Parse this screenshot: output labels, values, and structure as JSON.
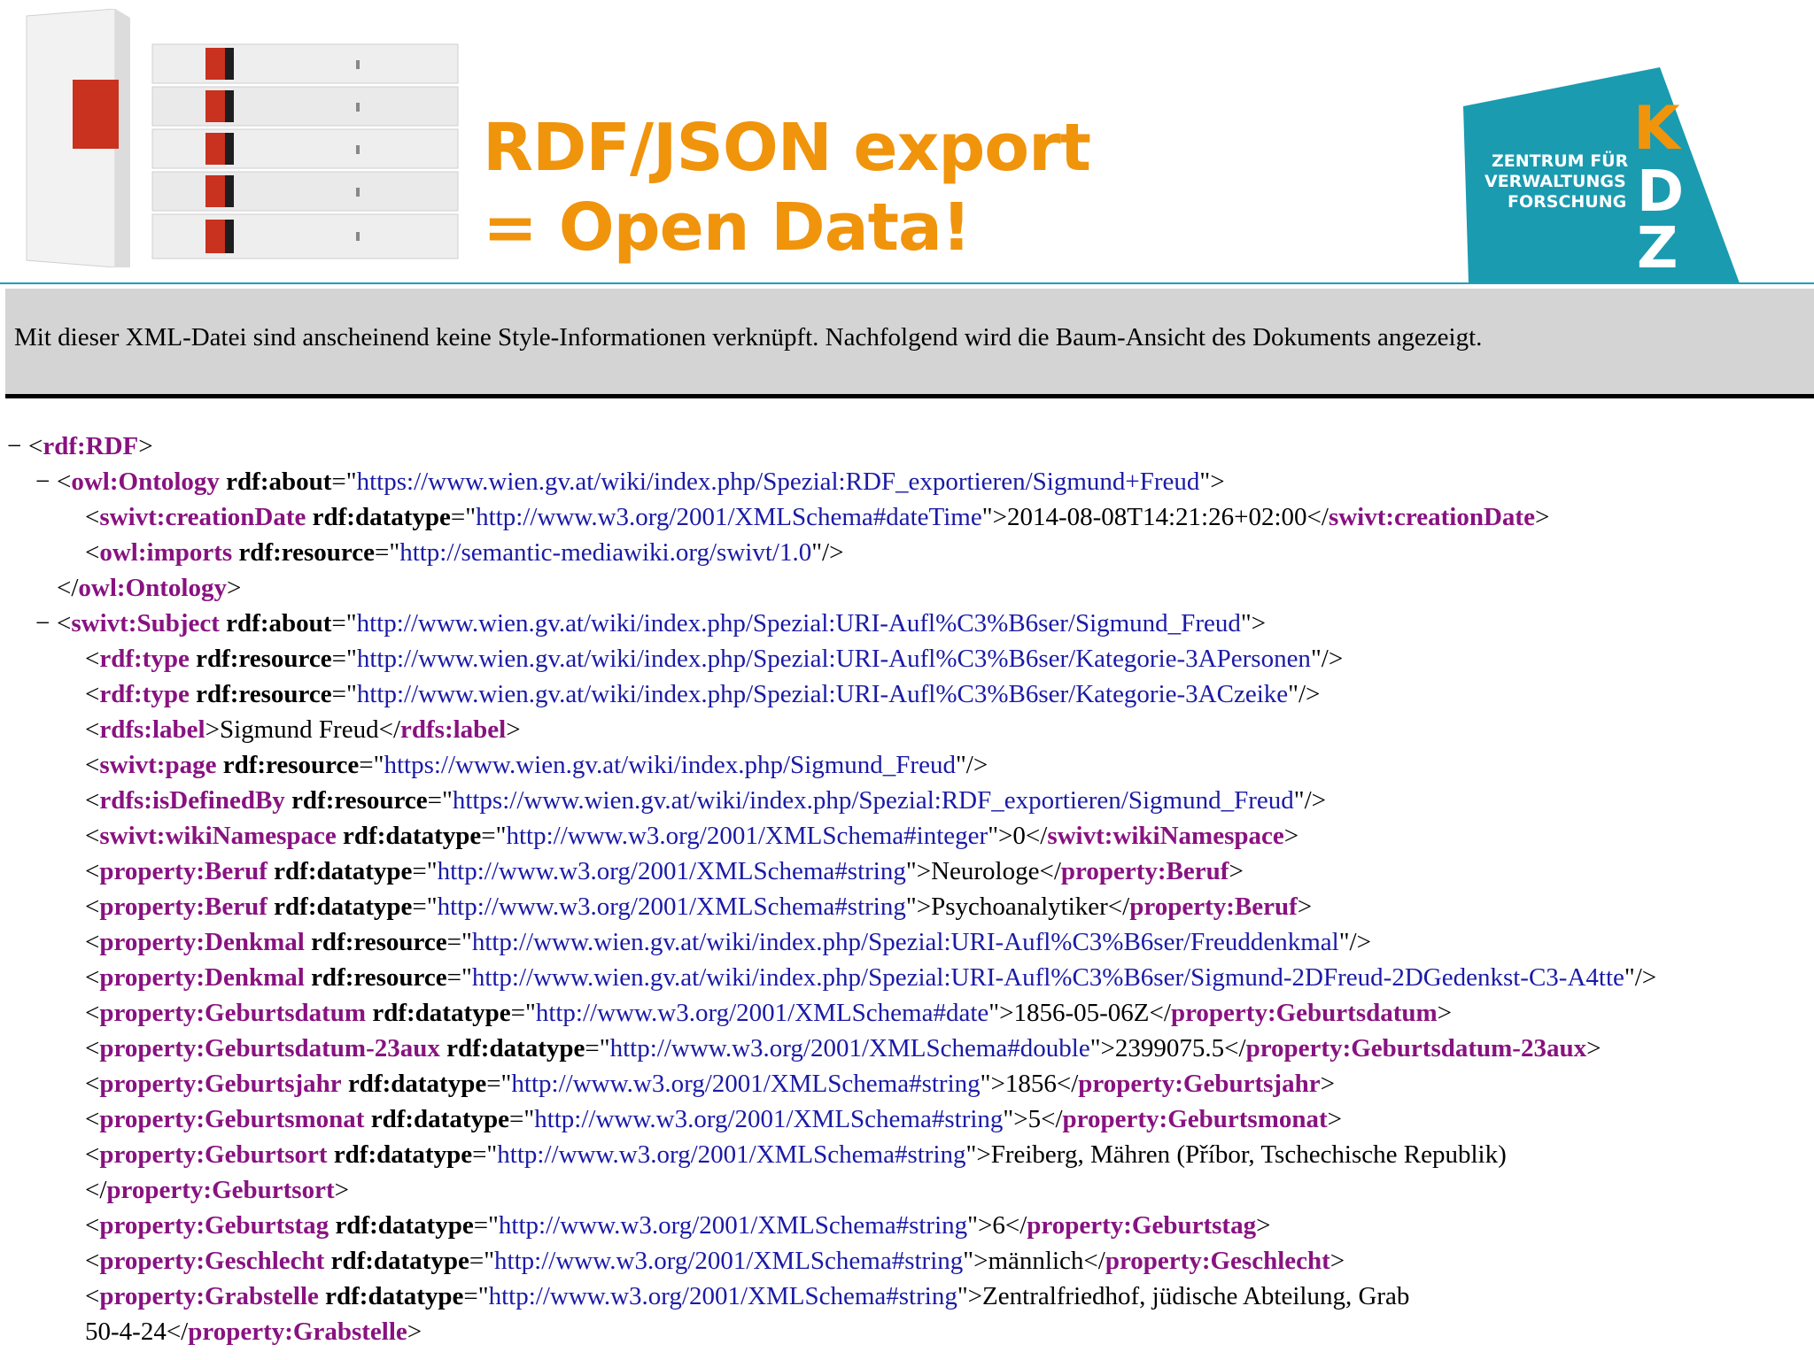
{
  "header": {
    "title_line1": "RDF/JSON export",
    "title_line2": "= Open Data!",
    "logo": {
      "text_line1": "ZENTRUM FÜR",
      "text_line2": "VERWALTUNGS",
      "text_line3": "FORSCHUNG",
      "letters": "KDZ",
      "color": "#1a9bb0"
    },
    "title_color": "#f0940c"
  },
  "infobar": {
    "message": "Mit dieser XML-Datei sind anscheinend keine Style-Informationen verknüpft. Nachfolgend wird die Baum-Ansicht des Dokuments angezeigt."
  },
  "colors": {
    "tag": "#881280",
    "attr_value": "#1a1aa6"
  },
  "tree": {
    "rdf_open": "rdf:RDF",
    "ontology": {
      "tag": "owl:Ontology",
      "about": "https://www.wien.gv.at/wiki/index.php/Spezial:RDF_exportieren/Sigmund+Freud",
      "creation_tag": "swivt:creationDate",
      "creation_type": "http://www.w3.org/2001/XMLSchema#dateTime",
      "creation_value": "2014-08-08T14:21:26+02:00",
      "imports_tag": "owl:imports",
      "imports_res": "http://semantic-mediawiki.org/swivt/1.0"
    },
    "subject": {
      "tag": "swivt:Subject",
      "about": "http://www.wien.gv.at/wiki/index.php/Spezial:URI-Aufl%C3%B6ser/Sigmund_Freud",
      "type1": "http://www.wien.gv.at/wiki/index.php/Spezial:URI-Aufl%C3%B6ser/Kategorie-3APersonen",
      "type2": "http://www.wien.gv.at/wiki/index.php/Spezial:URI-Aufl%C3%B6ser/Kategorie-3ACzeike",
      "label": "Sigmund Freud",
      "page": "https://www.wien.gv.at/wiki/index.php/Sigmund_Freud",
      "defined_by": "https://www.wien.gv.at/wiki/index.php/Spezial:RDF_exportieren/Sigmund_Freud",
      "namespace_type": "http://www.w3.org/2001/XMLSchema#integer",
      "namespace_value": "0",
      "beruf_type": "http://www.w3.org/2001/XMLSchema#string",
      "beruf1": "Neurologe",
      "beruf2": "Psychoanalytiker",
      "denkmal1": "http://www.wien.gv.at/wiki/index.php/Spezial:URI-Aufl%C3%B6ser/Freuddenkmal",
      "denkmal2": "http://www.wien.gv.at/wiki/index.php/Spezial:URI-Aufl%C3%B6ser/Sigmund-2DFreud-2DGedenkst-C3-A4tte",
      "geburtsdatum_type": "http://www.w3.org/2001/XMLSchema#date",
      "geburtsdatum": "1856-05-06Z",
      "geburtsdatum23_type": "http://www.w3.org/2001/XMLSchema#double",
      "geburtsdatum23": "2399075.5",
      "string_type": "http://www.w3.org/2001/XMLSchema#string",
      "geburtsjahr": "1856",
      "geburtsmonat": "5",
      "geburtsort": "Freiberg, Mähren (Příbor, Tschechische Republik)",
      "geburtstag": "6",
      "geschlecht": "männlich",
      "grabstelle_part1": "Zentralfriedhof, jüdische Abteilung, Grab",
      "grabstelle_part2": "50-4-24"
    }
  }
}
